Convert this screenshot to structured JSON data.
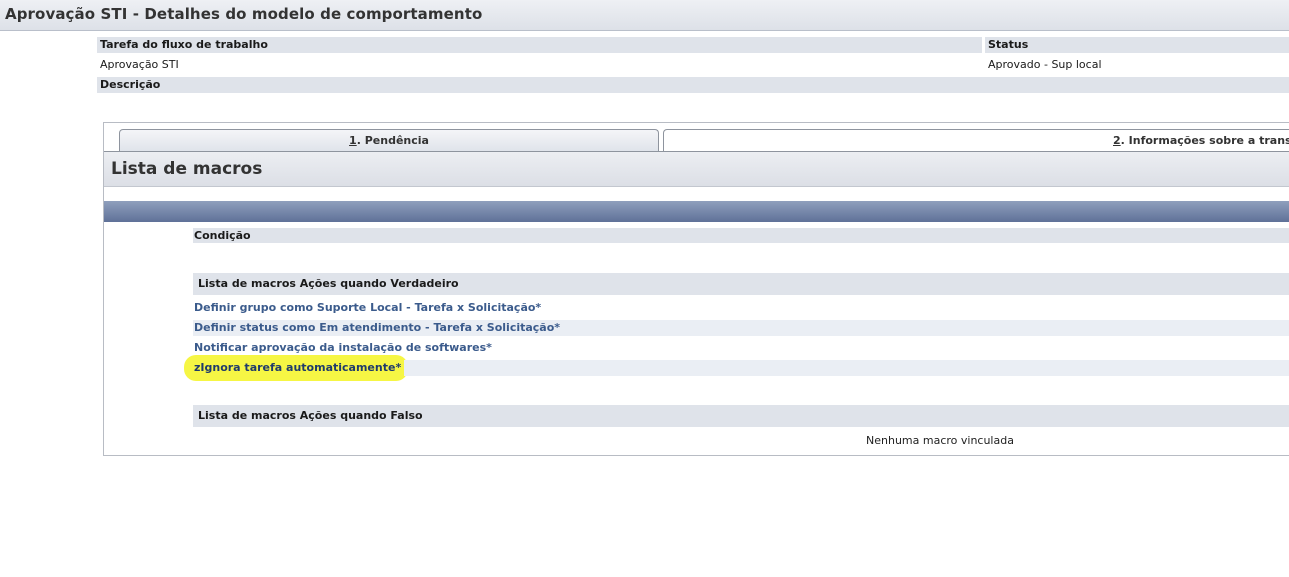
{
  "page": {
    "title": "Aprovação STI - Detalhes do modelo de comportamento"
  },
  "details": {
    "task_label": "Tarefa do fluxo de trabalho",
    "task_value": "Aprovação STI",
    "status_label": "Status",
    "status_value": "Aprovado - Sup local",
    "description_label": "Descrição"
  },
  "tabs": [
    {
      "key": "1",
      "label": ". Pendência",
      "active": true
    },
    {
      "key": "2",
      "label": ". Informações sobre a trans",
      "active": false
    }
  ],
  "section": {
    "title": "Lista de macros",
    "condition_label": "Condição",
    "true_actions_label": "Lista de macros Ações quando Verdadeiro",
    "true_actions": [
      "Definir grupo como Suporte Local - Tarefa x Solicitação*",
      "Definir status como Em atendimento - Tarefa x Solicitação*",
      "Notificar aprovação da instalação de softwares*",
      "zIgnora tarefa automaticamente*"
    ],
    "false_actions_label": "Lista de macros Ações quando Falso",
    "false_actions_empty": "Nenhuma macro vinculada"
  },
  "colors": {
    "highlight": "#f5f53a",
    "link": "#3b5b8c",
    "blue_bar": "#6a7ca2"
  }
}
